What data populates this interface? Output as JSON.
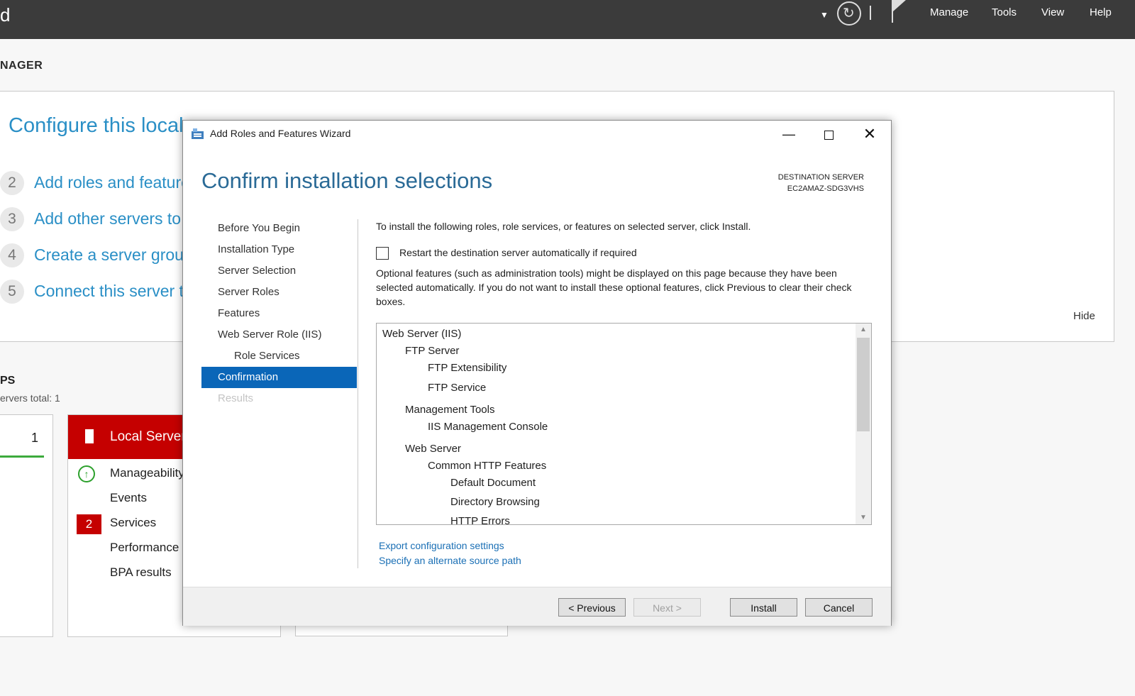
{
  "app": {
    "title_fragment": "d",
    "menu": [
      "Manage",
      "Tools",
      "View",
      "Help"
    ],
    "header": "NAGER"
  },
  "quick_start": {
    "title": "Configure this local",
    "items": [
      {
        "num": "2",
        "label": "Add roles and feature"
      },
      {
        "num": "3",
        "label": "Add other servers to"
      },
      {
        "num": "4",
        "label": "Create a server group"
      },
      {
        "num": "5",
        "label": "Connect this server to"
      }
    ],
    "hide": "Hide"
  },
  "groups": {
    "title": "PS",
    "subtitle": "ervers total: 1",
    "count_tile": "1",
    "local_server": {
      "name": "Local Server",
      "rows": [
        "Manageability",
        "Events",
        "Services",
        "Performance",
        "BPA results"
      ],
      "services_badge": "2"
    }
  },
  "wizard": {
    "window_title": "Add Roles and Features Wizard",
    "heading": "Confirm installation selections",
    "destination_label": "DESTINATION SERVER",
    "destination_server": "EC2AMAZ-SDG3VHS",
    "nav": [
      {
        "label": "Before You Begin"
      },
      {
        "label": "Installation Type"
      },
      {
        "label": "Server Selection"
      },
      {
        "label": "Server Roles"
      },
      {
        "label": "Features"
      },
      {
        "label": "Web Server Role (IIS)"
      },
      {
        "label": "Role Services"
      },
      {
        "label": "Confirmation"
      },
      {
        "label": "Results"
      }
    ],
    "intro": "To install the following roles, role services, or features on selected server, click Install.",
    "restart_label": "Restart the destination server automatically if required",
    "restart_checked": false,
    "optional_text": "Optional features (such as administration tools) might be displayed on this page because they have been selected automatically. If you do not want to install these optional features, click Previous to clear their check boxes.",
    "selections": [
      "Web Server (IIS)",
      "FTP Server",
      "FTP Extensibility",
      "FTP Service",
      "Management Tools",
      "IIS Management Console",
      "Web Server",
      "Common HTTP Features",
      "Default Document",
      "Directory Browsing",
      "HTTP Errors"
    ],
    "export_link": "Export configuration settings",
    "alternate_link": "Specify an alternate source path",
    "buttons": {
      "previous": "< Previous",
      "next": "Next >",
      "install": "Install",
      "cancel": "Cancel"
    }
  }
}
